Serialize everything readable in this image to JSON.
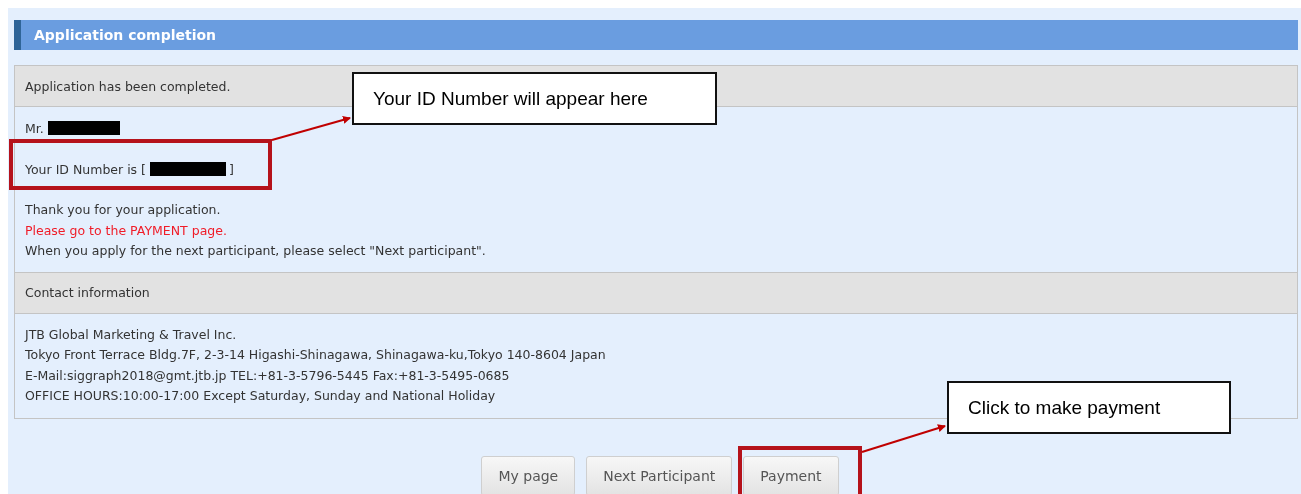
{
  "header": {
    "title": "Application completion"
  },
  "status_row": {
    "text": "Application has been completed."
  },
  "greeting": {
    "salutation": "Mr.",
    "name_hidden": true
  },
  "id_line": {
    "prefix": "Your ID Number is [",
    "suffix": "]",
    "id_hidden": true
  },
  "messages": [
    {
      "text": "Thank you for your application.",
      "kind": "normal"
    },
    {
      "text": "Please go to the PAYMENT page.",
      "kind": "alert"
    },
    {
      "text": "When you apply for the next participant, please select \"Next participant\".",
      "kind": "normal"
    }
  ],
  "contact": {
    "heading": "Contact information",
    "lines": [
      "JTB Global Marketing & Travel Inc.",
      "Tokyo Front Terrace Bldg.7F, 2-3-14 Higashi-Shinagawa, Shinagawa-ku,Tokyo 140-8604 Japan",
      "E-Mail:siggraph2018@gmt.jtb.jp TEL:+81-3-5796-5445 Fax:+81-3-5495-0685",
      "OFFICE HOURS:10:00-17:00 Except Saturday, Sunday and National Holiday"
    ]
  },
  "buttons": [
    "My page",
    "Next Participant",
    "Payment"
  ],
  "annotations": [
    {
      "text": "Your ID Number will appear here",
      "kind": "id"
    },
    {
      "text": "Click to make payment",
      "kind": "payment"
    }
  ]
}
